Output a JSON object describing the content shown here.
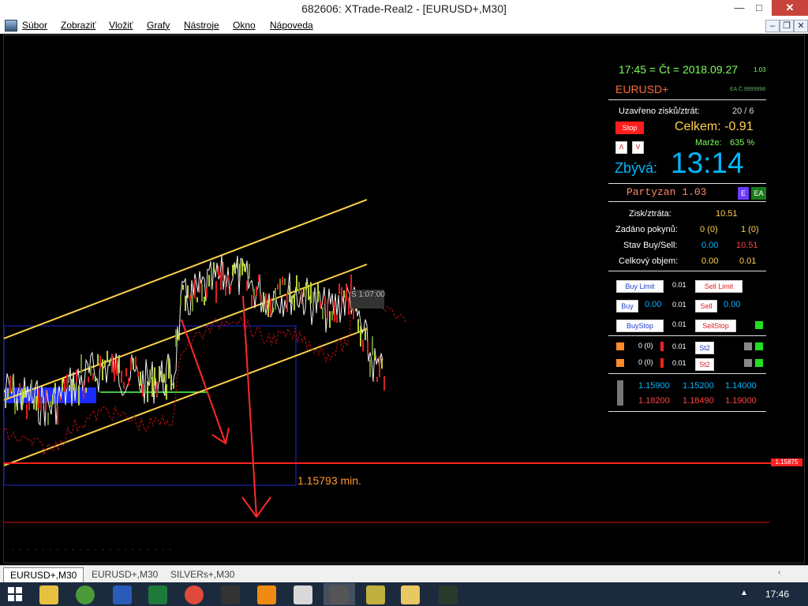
{
  "window": {
    "title": "682606: XTrade-Real2 - [EURUSD+,M30]",
    "min_glyph": "—",
    "max_glyph": "□",
    "close_glyph": "✕"
  },
  "menu": {
    "items": [
      "Súbor",
      "Zobraziť",
      "Vložiť",
      "Grafy",
      "Nástroje",
      "Okno",
      "Nápoveda"
    ]
  },
  "chart": {
    "time_display": "17:45 = Čt = 2018.09.27",
    "time_suffix": "1.03",
    "symbol": "EURUSD+",
    "ea_small": "EA Č.9999998",
    "closed_label": "Uzavřeno zisků/ztrát:",
    "closed_value": "20 / 6",
    "stop_button": "Stop",
    "total_label": "Celkem: -0.91",
    "margin_label": "Marže:",
    "margin_value": "635 %",
    "remaining_label": "Zbývá:",
    "remaining_value": "13:14",
    "ea_name": "Partyzan 1.03",
    "ea_e": "E",
    "ea_ea": "EA",
    "profit_label": "Zisk/ztráta:",
    "profit_value": "10.51",
    "orders_label": "Zadáno pokynů:",
    "orders_buy": "0 (0)",
    "orders_sell": "1 (0)",
    "state_label": "Stav Buy/Sell:",
    "state_buy": "0.00",
    "state_sell": "10.51",
    "volume_label": "Celkový objem:",
    "volume_buy": "0.00",
    "volume_sell": "0.01",
    "buy_limit": "Buy Limit",
    "sell_limit": "Sell Limit",
    "buy": "Buy",
    "sell": "Sell",
    "buy_stop": "BuyStop",
    "sell_stop": "SellStop",
    "lot": "0.01",
    "buy_price": "0.00",
    "sell_price": "0.00",
    "st2": "St2",
    "counter": "0 (0)",
    "levels_row1": [
      "1.15900",
      "1.15200",
      "1.14000"
    ],
    "levels_row2": [
      "1.18200",
      "1.18490",
      "1.19000"
    ],
    "min_label": "1.15793 min.",
    "price_tag": "1.15875",
    "timer_tag": "S 1:07:00"
  },
  "tabs": [
    "EURUSD+,M30",
    "EURUSD+,M30",
    "SILVERs+,M30"
  ],
  "taskbar": {
    "clock": "17:46"
  },
  "colors": {
    "accent_blue": "#00b7ff",
    "yellow_line": "#ffd24a",
    "red": "#ff2020"
  }
}
